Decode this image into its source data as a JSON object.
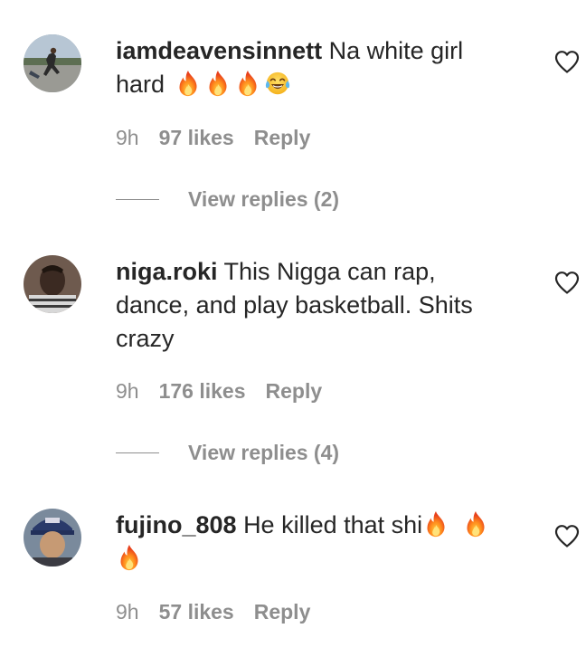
{
  "comments": [
    {
      "username": "iamdeavensinnett",
      "text": "Na white girl hard",
      "emojis": [
        "fire-emoji",
        "fire-emoji",
        "fire-emoji",
        "tears-of-joy-emoji"
      ],
      "time": "9h",
      "likes": "97 likes",
      "reply": "Reply",
      "view_replies": "View replies (2)"
    },
    {
      "username": "niga.roki",
      "text": "This Nigga can rap, dance, and play basketball. Shits crazy",
      "time": "9h",
      "likes": "176 likes",
      "reply": "Reply",
      "view_replies": "View replies (4)"
    },
    {
      "username": "fujino_808",
      "text": "He killed that shi",
      "emojis": [
        "fire-emoji",
        "fire-emoji",
        "fire-emoji"
      ],
      "time": "9h",
      "likes": "57 likes",
      "reply": "Reply"
    }
  ],
  "icons": {
    "like": "heart-outline-icon"
  },
  "colors": {
    "text": "#262626",
    "secondary": "#8e8e8e",
    "background": "#ffffff"
  }
}
